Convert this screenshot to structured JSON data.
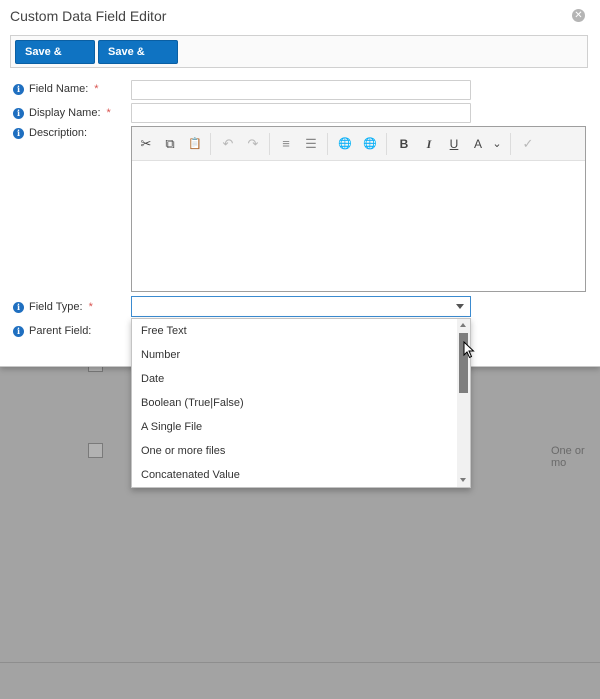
{
  "dialog": {
    "title": "Custom Data Field Editor",
    "close_glyph": "✕"
  },
  "toolbar": {
    "save_close": "Save & Close",
    "save_new": "Save & New"
  },
  "info_glyph": "i",
  "required_mark": "*",
  "fields": {
    "field_name": {
      "label": "Field Name:",
      "value": ""
    },
    "display_name": {
      "label": "Display Name:",
      "value": ""
    },
    "description": {
      "label": "Description:"
    },
    "field_type": {
      "label": "Field Type:",
      "value": ""
    },
    "parent_field": {
      "label": "Parent Field:"
    }
  },
  "editor_tools": {
    "cut": "✂",
    "copy": "⧉",
    "paste": "📋",
    "undo": "↶",
    "redo": "↷",
    "ordered_list": "≡",
    "bullet_list": "☰",
    "link": "🌐",
    "unlink": "🌐",
    "bold": "B",
    "italic": "I",
    "underline": "U",
    "font_color": "A",
    "chevron": "⌄",
    "spellcheck": "✓"
  },
  "dropdown": {
    "options": [
      "Free Text",
      "Number",
      "Date",
      "Boolean (True|False)",
      "A Single File",
      "One or more files",
      "Concatenated Value"
    ]
  },
  "background": {
    "cell_text": "One or mo"
  },
  "colors": {
    "primary": "#0f73c2",
    "info": "#1f6fc0",
    "required": "#d9534f"
  }
}
